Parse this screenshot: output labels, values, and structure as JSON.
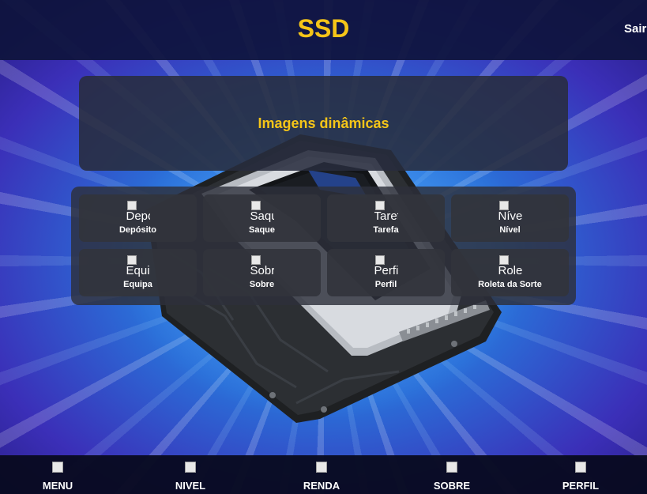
{
  "header": {
    "title": "SSD",
    "exit_label": "Sair"
  },
  "banner": {
    "text": "Imagens dinâmicas"
  },
  "tiles": [
    {
      "alt": "Depósito",
      "label": "Depósito",
      "icon": "deposit-icon"
    },
    {
      "alt": "Saque",
      "label": "Saque",
      "icon": "withdraw-icon"
    },
    {
      "alt": "Tarefa",
      "label": "Tarefa",
      "icon": "task-icon"
    },
    {
      "alt": "Nível",
      "label": "Nível",
      "icon": "level-icon"
    },
    {
      "alt": "Equipa",
      "label": "Equipa",
      "icon": "team-icon"
    },
    {
      "alt": "Sobre",
      "label": "Sobre",
      "icon": "about-icon"
    },
    {
      "alt": "Perfil",
      "label": "Perfil",
      "icon": "profile-icon"
    },
    {
      "alt": "Roleta da Sorte",
      "label": "Roleta da Sorte",
      "icon": "roulette-icon"
    }
  ],
  "bottom_nav": [
    {
      "label": "MENU",
      "icon": "menu-icon"
    },
    {
      "label": "NIVEL",
      "icon": "level-icon"
    },
    {
      "label": "RENDA",
      "icon": "income-icon"
    },
    {
      "label": "SOBRE",
      "icon": "about-icon"
    },
    {
      "label": "PERFIL",
      "icon": "profile-icon"
    }
  ],
  "colors": {
    "accent": "#f5c518",
    "header_bg": "#0e143c",
    "tile_bg": "#32343c"
  }
}
